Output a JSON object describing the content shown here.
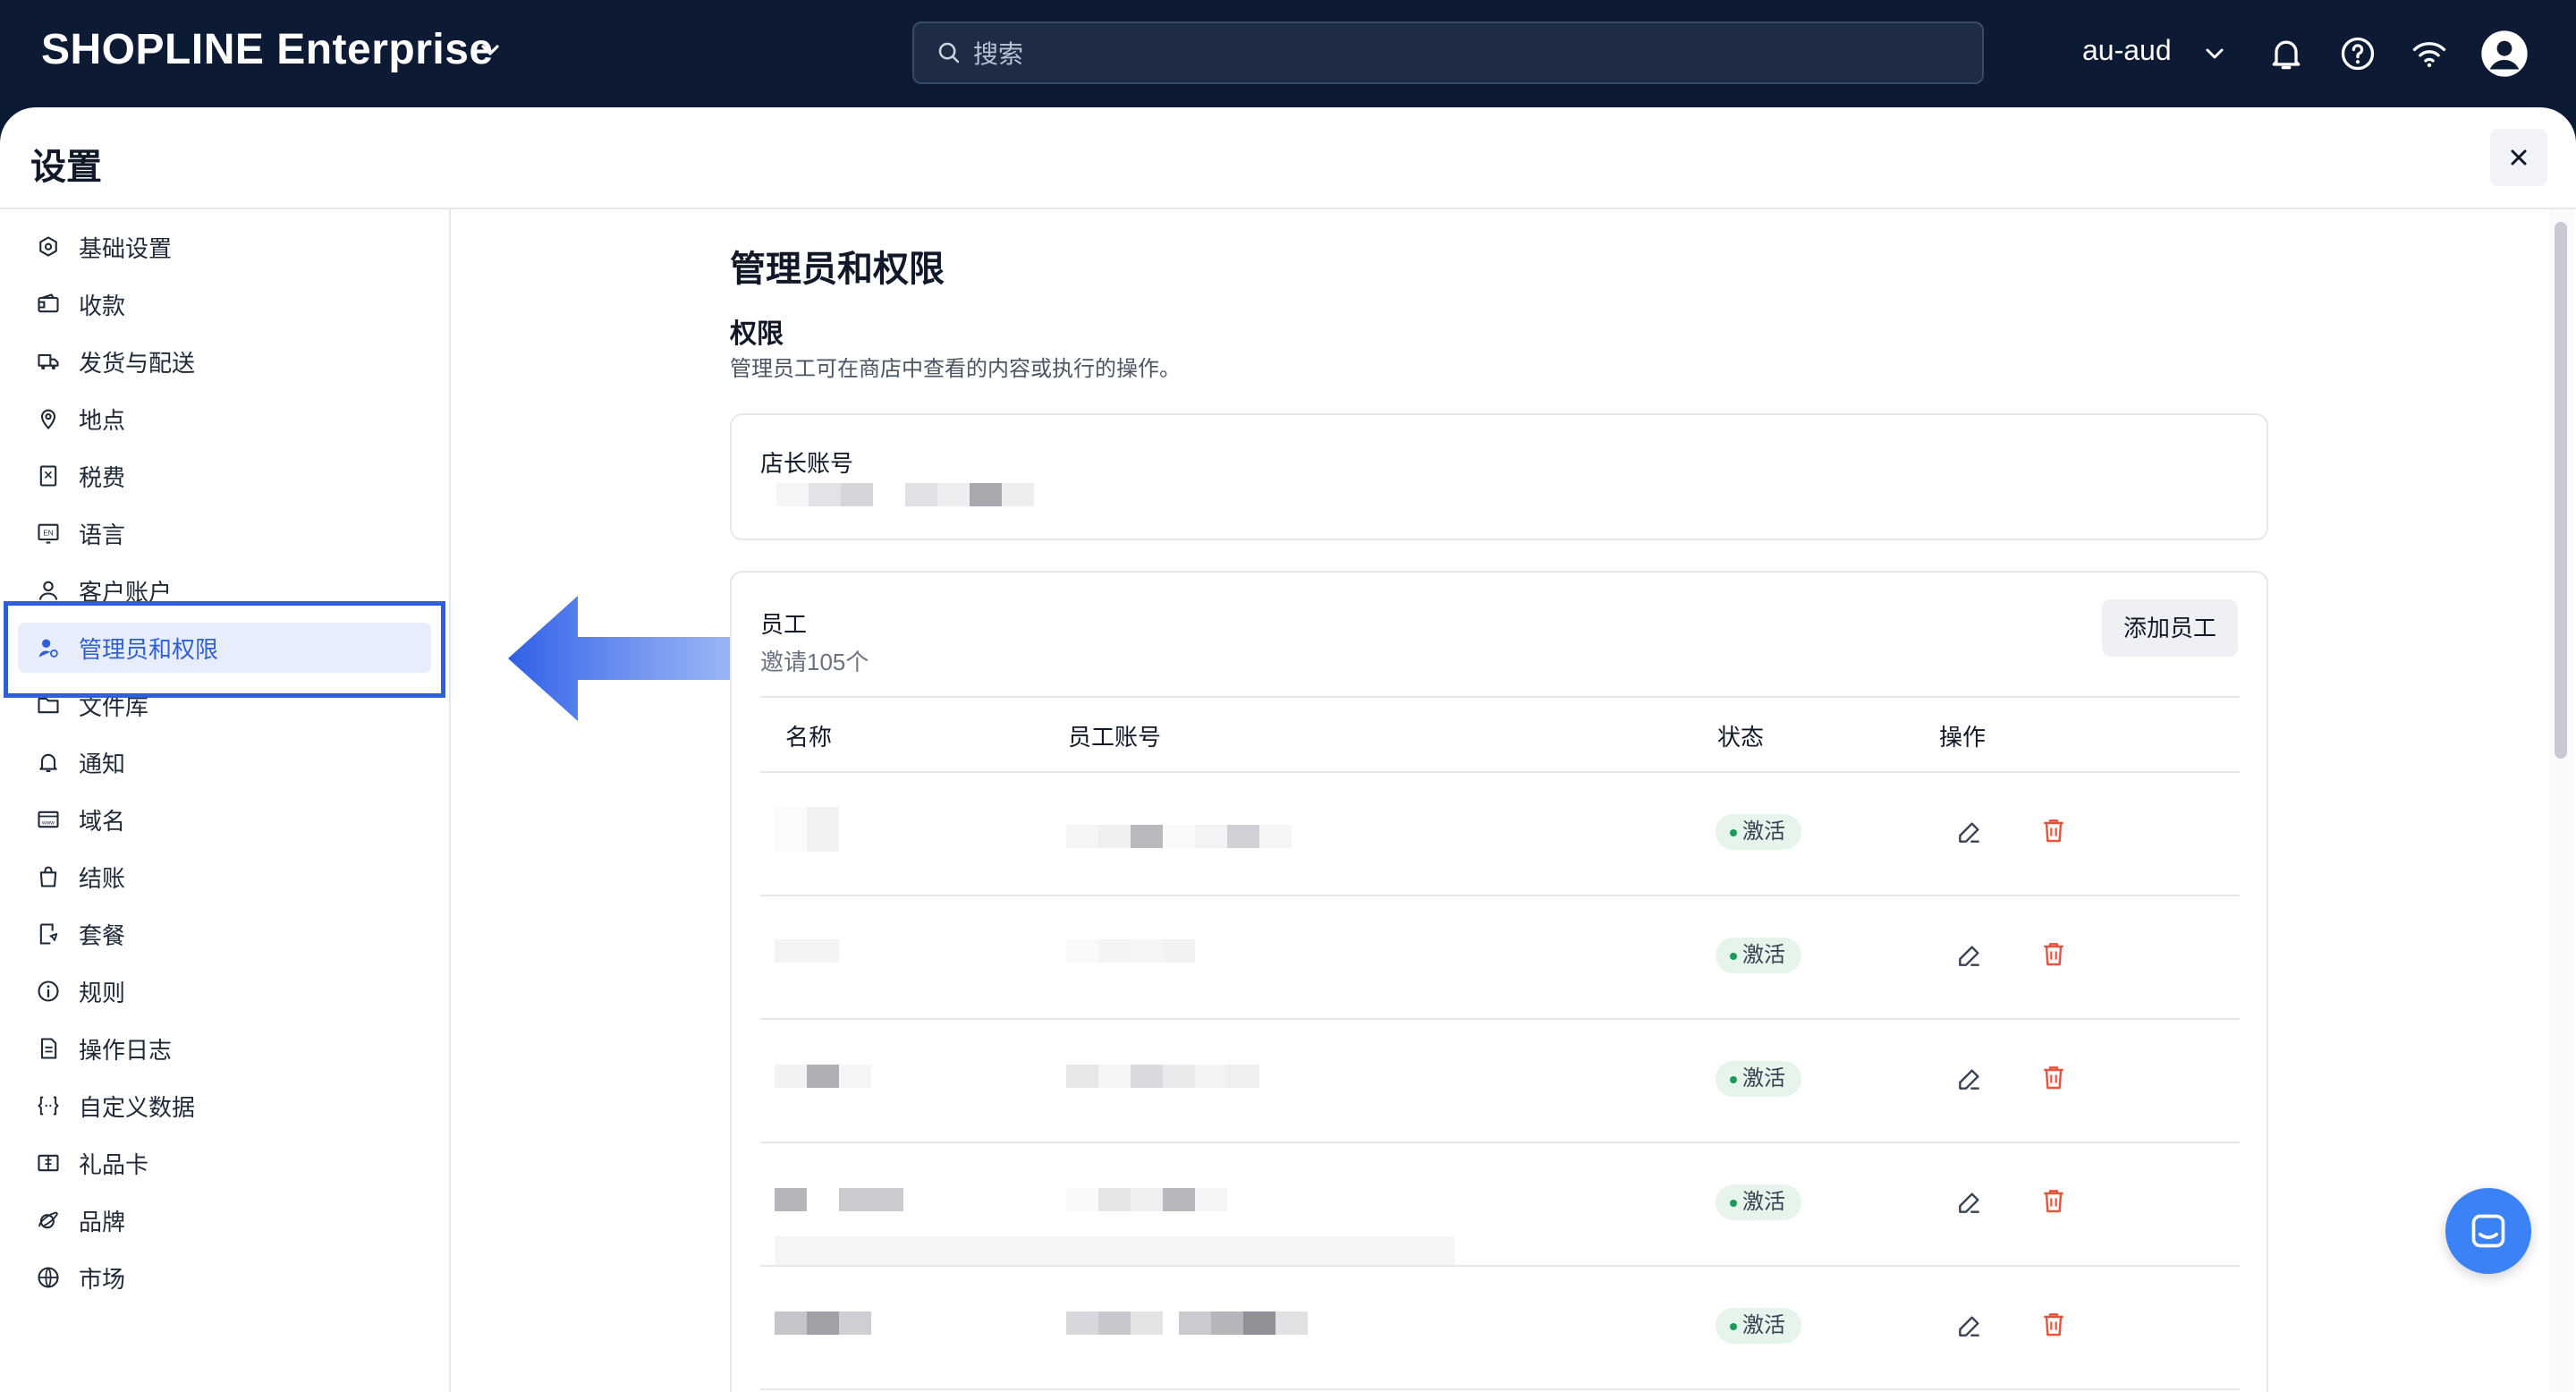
{
  "topbar": {
    "brand": "SHOPLINE Enterprise",
    "search_placeholder": "搜索",
    "store": "au-aud"
  },
  "settings": {
    "title": "设置",
    "sidebar": [
      {
        "label": "基础设置",
        "icon": "gear-icon"
      },
      {
        "label": "收款",
        "icon": "wallet-icon"
      },
      {
        "label": "发货与配送",
        "icon": "truck-icon"
      },
      {
        "label": "地点",
        "icon": "location-pin-icon"
      },
      {
        "label": "税费",
        "icon": "receipt-icon"
      },
      {
        "label": "语言",
        "icon": "language-icon"
      },
      {
        "label": "客户账户",
        "icon": "user-icon"
      },
      {
        "label": "管理员和权限",
        "icon": "user-admin-icon",
        "active": true
      },
      {
        "label": "文件库",
        "icon": "folder-icon"
      },
      {
        "label": "通知",
        "icon": "bell-icon"
      },
      {
        "label": "域名",
        "icon": "domain-icon"
      },
      {
        "label": "结账",
        "icon": "shopping-bag-icon"
      },
      {
        "label": "套餐",
        "icon": "plan-icon"
      },
      {
        "label": "规则",
        "icon": "info-icon"
      },
      {
        "label": "操作日志",
        "icon": "log-icon"
      },
      {
        "label": "自定义数据",
        "icon": "code-icon"
      },
      {
        "label": "礼品卡",
        "icon": "gift-card-icon"
      },
      {
        "label": "品牌",
        "icon": "brand-icon"
      },
      {
        "label": "市场",
        "icon": "globe-icon"
      }
    ]
  },
  "main": {
    "page_title": "管理员和权限",
    "section_title": "权限",
    "section_desc": "管理员工可在商店中查看的内容或执行的操作。",
    "owner_card_title": "店长账号",
    "staff_card": {
      "title": "员工",
      "subtitle": "邀请105个",
      "add_button": "添加员工",
      "columns": [
        "名称",
        "员工账号",
        "状态",
        "操作"
      ],
      "rows": [
        {
          "status": "激活"
        },
        {
          "status": "激活"
        },
        {
          "status": "激活"
        },
        {
          "status": "激活"
        },
        {
          "status": "激活"
        }
      ]
    }
  },
  "colors": {
    "accent": "#2f5fd8",
    "topbar": "#0d1a33",
    "status_green": "#1a9a57",
    "delete_red": "#e5533d"
  }
}
